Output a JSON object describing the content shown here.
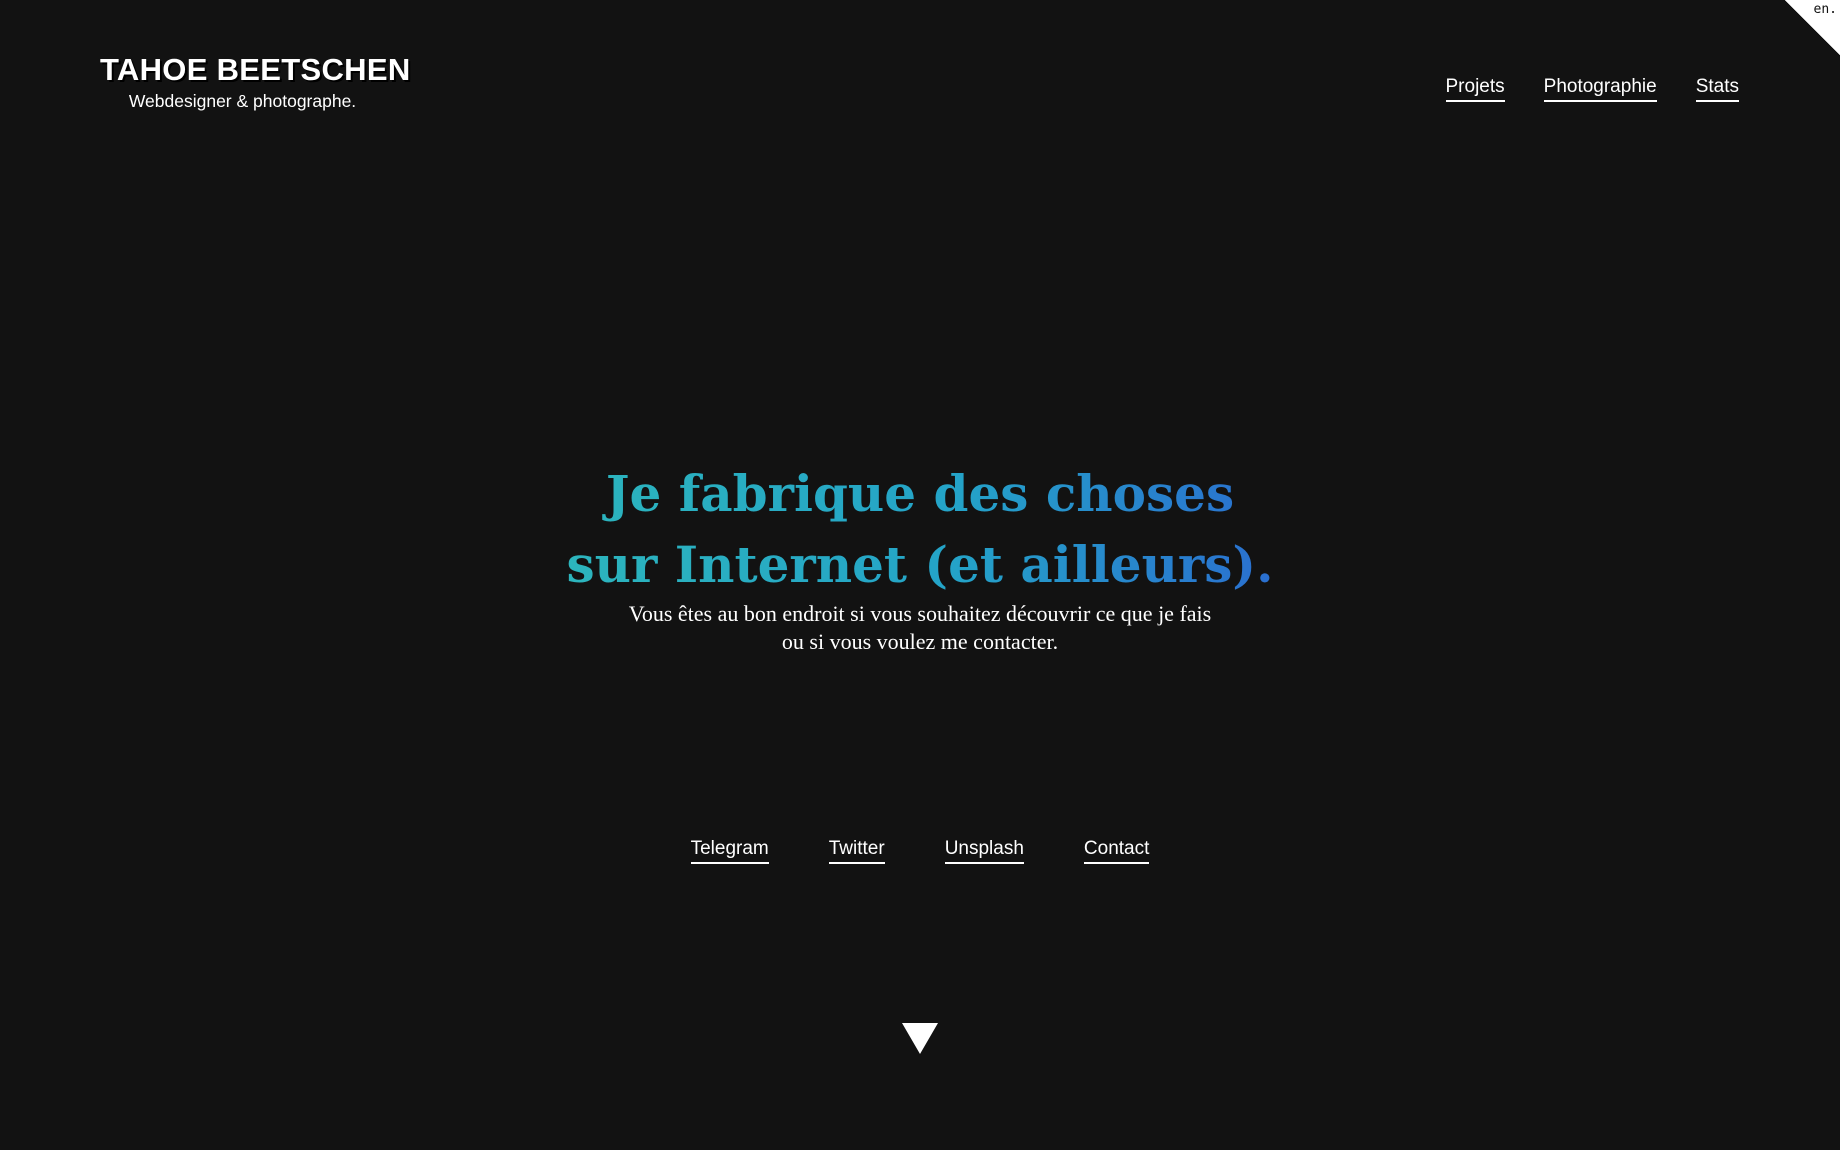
{
  "header": {
    "brand_name": "TAHOE BEETSCHEN",
    "brand_tagline": "Webdesigner & photographe.",
    "nav": [
      "Projets",
      "Photographie",
      "Stats"
    ],
    "language_toggle": "en."
  },
  "hero": {
    "headline_line1": "Je fabrique des choses",
    "headline_line2": "sur Internet (et ailleurs).",
    "intro": "Vous êtes au bon endroit si vous souhaitez découvrir ce que je fais ou si vous voulez me contacter."
  },
  "social_links": [
    "Telegram",
    "Twitter",
    "Unsplash",
    "Contact"
  ],
  "scroll_icon": "down-triangle-icon",
  "colors": {
    "background": "#121212",
    "text": "#ffffff",
    "accent_start": "#2cb5bd",
    "accent_end": "#2a6fd0"
  }
}
